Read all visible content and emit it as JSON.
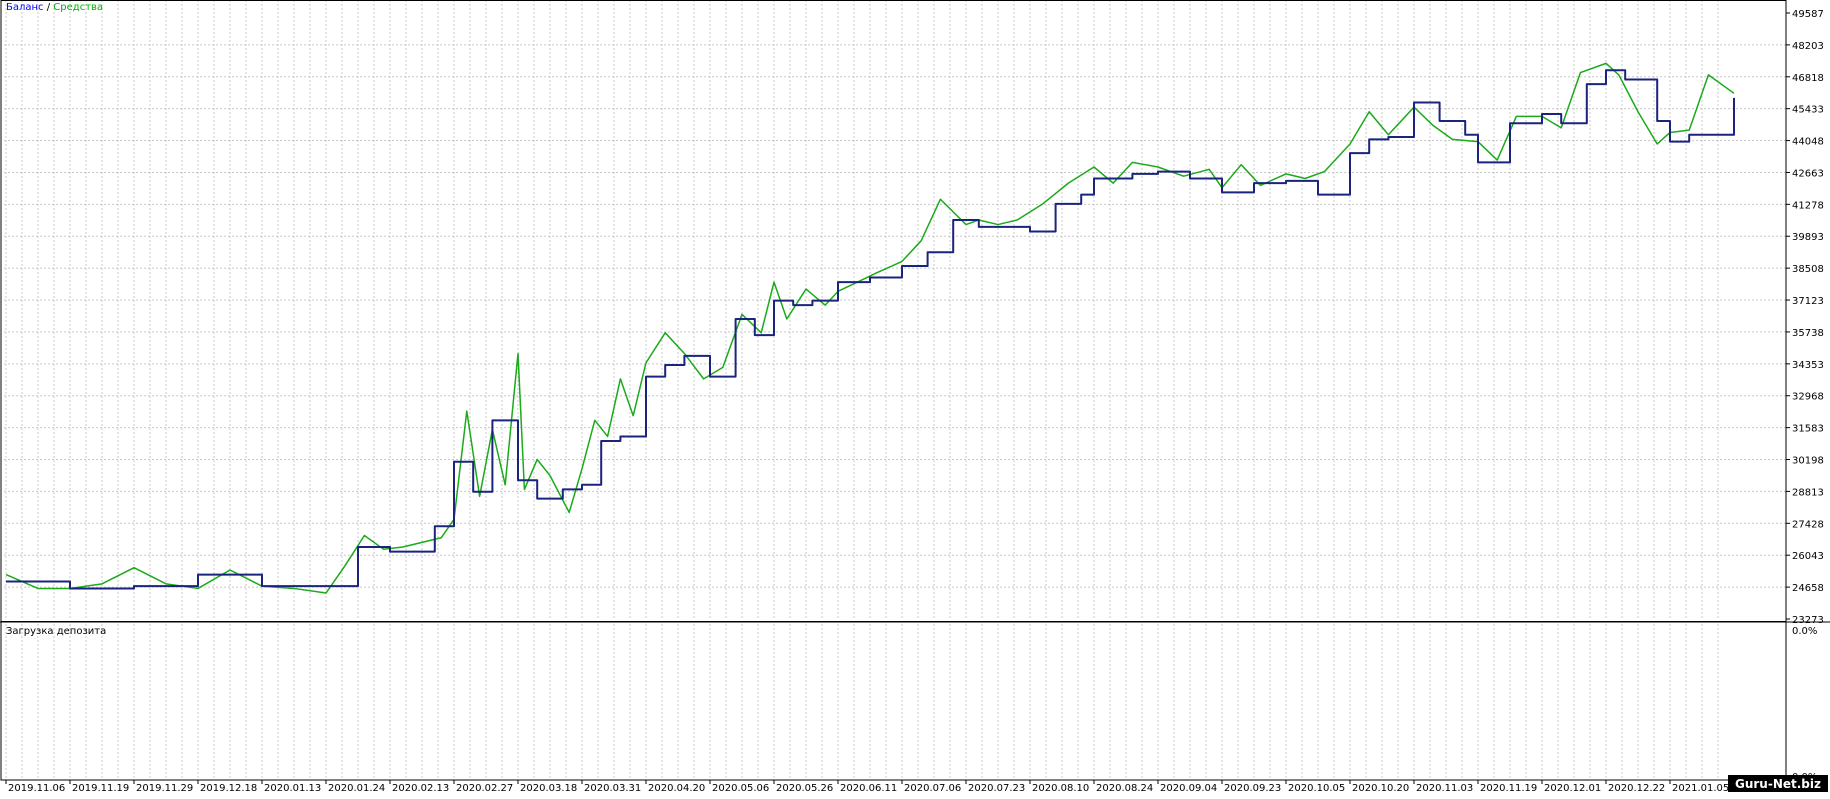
{
  "legend": {
    "balance_label": "Баланс",
    "separator": "/",
    "equity_label": "Средства",
    "balance_color": "#0000ff",
    "equity_color": "#00b000"
  },
  "subwindow": {
    "title": "Загрузка депозита",
    "y_ticks": [
      "0.0%",
      "0.0%"
    ]
  },
  "watermark": "Guru-Net.biz",
  "colors": {
    "balance_line": "#1a237e",
    "equity_line": "#1aaa1a",
    "grid": "#c8c8c8",
    "axis": "#000000"
  },
  "chart_data": {
    "type": "line",
    "title": "",
    "x_tick_labels": [
      "2019.11.06",
      "2019.11.19",
      "2019.11.29",
      "2019.12.18",
      "2020.01.13",
      "2020.01.24",
      "2020.02.13",
      "2020.02.27",
      "2020.03.18",
      "2020.03.31",
      "2020.04.20",
      "2020.05.06",
      "2020.05.26",
      "2020.06.11",
      "2020.07.06",
      "2020.07.23",
      "2020.08.10",
      "2020.08.24",
      "2020.09.04",
      "2020.09.23",
      "2020.10.05",
      "2020.10.20",
      "2020.11.03",
      "2020.11.19",
      "2020.12.01",
      "2020.12.22",
      "2021.01.05"
    ],
    "y_tick_labels": [
      "49587",
      "48203",
      "46818",
      "45433",
      "44048",
      "42663",
      "41278",
      "39893",
      "38508",
      "37123",
      "35738",
      "34353",
      "32968",
      "31583",
      "30198",
      "28813",
      "27428",
      "26043",
      "24658",
      "23273"
    ],
    "ylim": [
      23273,
      49587
    ],
    "grid": true,
    "legend_position": "top-left",
    "series": [
      {
        "name": "Баланс",
        "x_index": [
          0,
          1,
          2,
          3,
          4,
          5,
          5.5,
          6,
          6.4,
          6.7,
          7,
          7.3,
          7.6,
          8,
          8.3,
          8.7,
          9,
          9.3,
          9.6,
          10,
          10.3,
          10.6,
          11,
          11.4,
          11.7,
          12,
          12.3,
          12.6,
          13,
          13.5,
          14,
          14.4,
          14.8,
          15,
          15.2,
          15.6,
          16,
          16.4,
          16.8,
          17,
          17.3,
          17.6,
          18,
          18.5,
          19,
          19.5,
          20,
          20.5,
          21,
          21.3,
          21.6,
          22,
          22.4,
          22.8,
          23,
          23.5,
          24,
          24.3,
          24.7,
          25,
          25.3,
          25.8,
          26,
          26.3,
          26.7,
          27
        ],
        "values": [
          24900,
          24600,
          24700,
          25200,
          24700,
          24700,
          26400,
          26200,
          26200,
          27300,
          30100,
          28800,
          31900,
          29300,
          28500,
          28900,
          29100,
          31000,
          31200,
          33800,
          34300,
          34700,
          33800,
          36300,
          35600,
          37100,
          36900,
          37100,
          37900,
          38100,
          38600,
          39200,
          40600,
          40600,
          40300,
          40300,
          40100,
          41300,
          41700,
          42400,
          42400,
          42600,
          42700,
          42400,
          41800,
          42200,
          42300,
          41700,
          43500,
          44100,
          44200,
          45700,
          44900,
          44300,
          43100,
          44800,
          45200,
          44800,
          46500,
          47100,
          46700,
          44900,
          44000,
          44300,
          44300,
          45900
        ]
      },
      {
        "name": "Средства",
        "x_index": [
          0,
          0.5,
          1,
          1.5,
          2,
          2.5,
          3,
          3.5,
          4,
          4.5,
          5,
          5.3,
          5.6,
          5.9,
          6.2,
          6.5,
          6.8,
          7,
          7.2,
          7.4,
          7.6,
          7.8,
          8,
          8.1,
          8.3,
          8.5,
          8.8,
          9,
          9.2,
          9.4,
          9.6,
          9.8,
          10,
          10.3,
          10.6,
          10.9,
          11.2,
          11.5,
          11.8,
          12,
          12.2,
          12.5,
          12.8,
          13,
          13.3,
          13.6,
          14,
          14.3,
          14.6,
          15,
          15.2,
          15.5,
          15.8,
          16.2,
          16.6,
          17,
          17.3,
          17.6,
          18,
          18.4,
          18.8,
          19,
          19.3,
          19.6,
          20,
          20.3,
          20.6,
          21,
          21.3,
          21.6,
          22,
          22.3,
          22.6,
          23,
          23.3,
          23.6,
          24,
          24.3,
          24.6,
          25,
          25.2,
          25.5,
          25.8,
          26,
          26.3,
          26.6,
          27
        ],
        "values": [
          25200,
          24600,
          24600,
          24800,
          25500,
          24800,
          24600,
          25400,
          24700,
          24600,
          24400,
          25600,
          26900,
          26300,
          26400,
          26600,
          26800,
          27600,
          32300,
          28600,
          31500,
          29100,
          34800,
          28900,
          30200,
          29500,
          27900,
          29800,
          31900,
          31200,
          33700,
          32100,
          34400,
          35700,
          34800,
          33700,
          34200,
          36500,
          35700,
          37900,
          36300,
          37600,
          36900,
          37500,
          37900,
          38300,
          38800,
          39700,
          41500,
          40400,
          40600,
          40400,
          40600,
          41300,
          42200,
          42900,
          42200,
          43100,
          42900,
          42500,
          42800,
          42000,
          43000,
          42100,
          42600,
          42400,
          42700,
          43900,
          45300,
          44300,
          45500,
          44700,
          44100,
          44000,
          43200,
          45100,
          45100,
          44600,
          47000,
          47400,
          46900,
          45300,
          43900,
          44400,
          44500,
          46900,
          46100
        ]
      }
    ]
  }
}
